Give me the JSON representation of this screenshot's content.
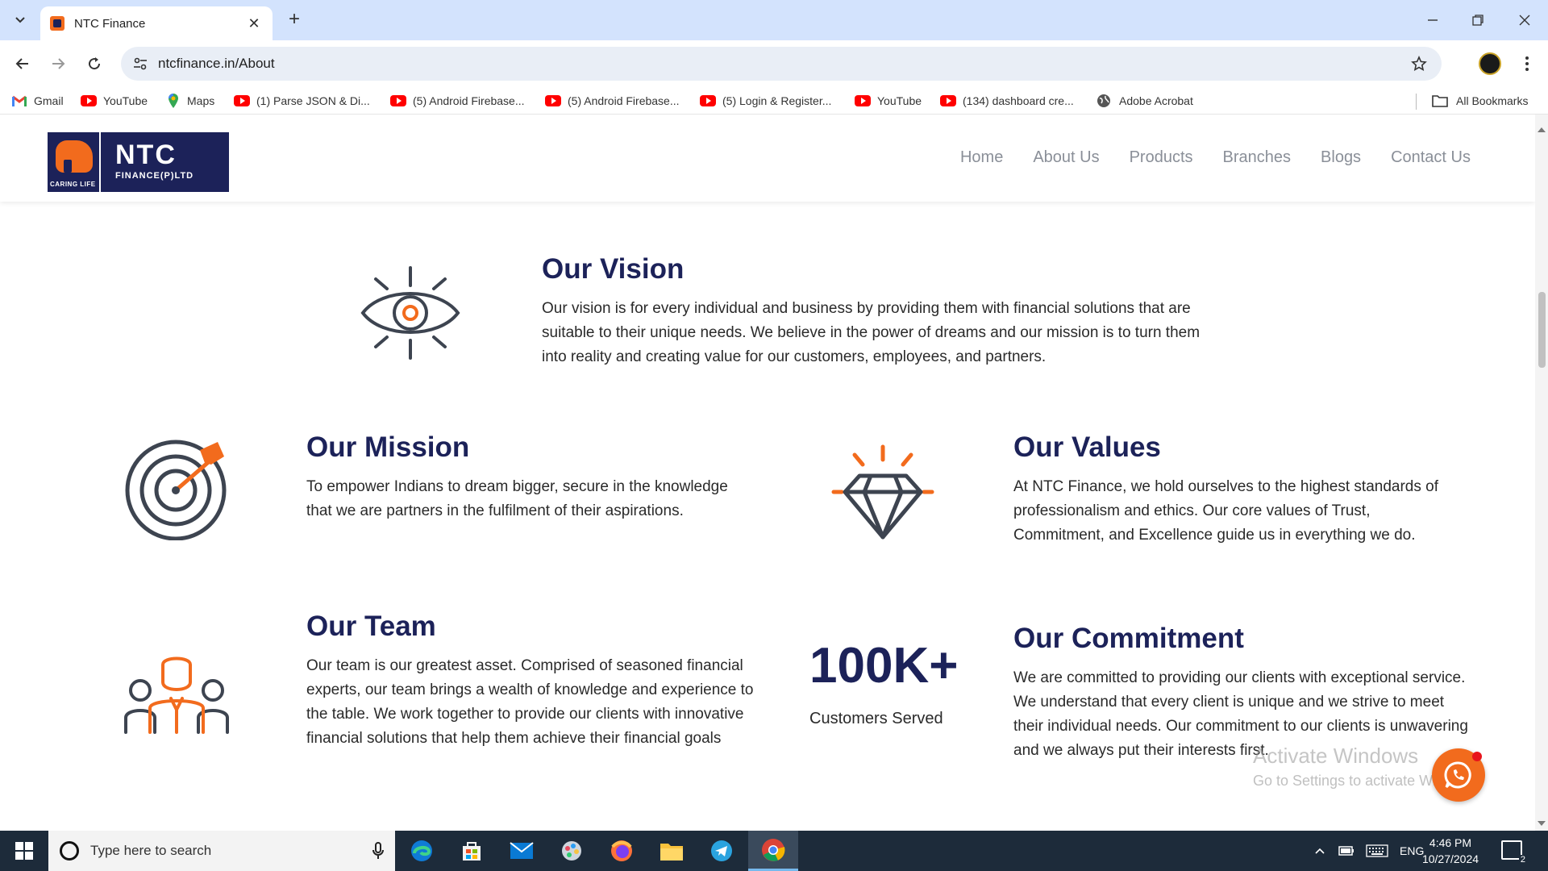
{
  "browser": {
    "tab_title": "NTC Finance",
    "url": "ntcfinance.in/About",
    "new_tab_symbol": "+",
    "close_symbol": "✕"
  },
  "bookmarks": {
    "items": [
      {
        "label": "Gmail",
        "icon": "gmail-icon"
      },
      {
        "label": "YouTube",
        "icon": "youtube-icon"
      },
      {
        "label": "Maps",
        "icon": "maps-icon"
      },
      {
        "label": "(1) Parse JSON & Di...",
        "icon": "youtube-icon"
      },
      {
        "label": "(5) Android Firebase...",
        "icon": "youtube-icon"
      },
      {
        "label": "(5) Android Firebase...",
        "icon": "youtube-icon"
      },
      {
        "label": "(5) Login & Register...",
        "icon": "youtube-icon"
      },
      {
        "label": "YouTube",
        "icon": "youtube-icon"
      },
      {
        "label": "(134) dashboard cre...",
        "icon": "youtube-icon"
      },
      {
        "label": "Adobe Acrobat",
        "icon": "globe-icon"
      }
    ],
    "all_bookmarks": "All Bookmarks"
  },
  "site": {
    "logo": {
      "name": "NTC",
      "sub": "FINANCE(P)LTD",
      "tagline": "CARING LIFE"
    },
    "nav": [
      "Home",
      "About Us",
      "Products",
      "Branches",
      "Blogs",
      "Contact Us"
    ]
  },
  "vision": {
    "title_prefix": "Our",
    "title_bold": "Vision",
    "text": "Our vision is for every individual and business by providing them with financial solutions that are suitable to their unique needs. We believe in the power of dreams and our mission is to turn them into reality and creating value for our customers, employees, and partners."
  },
  "mission": {
    "title_prefix": "Our",
    "title_bold": "Mission",
    "text": "To empower Indians to dream bigger, secure in the knowledge that we are partners in the fulfilment of their aspirations."
  },
  "values": {
    "title_prefix": "Our",
    "title_bold": "Values",
    "text": "At NTC Finance, we hold ourselves to the highest standards of professionalism and ethics. Our core values of Trust, Commitment, and Excellence guide us in everything we do."
  },
  "team": {
    "title_prefix": "Our",
    "title_bold": "Team",
    "text": "Our team is our greatest asset. Comprised of seasoned financial experts, our team brings a wealth of knowledge and experience to the table. We work together to provide our clients with innovative financial solutions that help them achieve their financial goals"
  },
  "stats": {
    "number": "100K+",
    "label": "Customers Served"
  },
  "commitment": {
    "title_prefix": "Our",
    "title_bold": "Commitment",
    "text": "We are committed to providing our clients with exceptional service. We understand that every client is unique and we strive to meet their individual needs. Our commitment to our clients is unwavering and we always put their interests first."
  },
  "watermark": {
    "line1": "Activate Windows",
    "line2": "Go to Settings to activate Windows."
  },
  "taskbar": {
    "search_placeholder": "Type here to search",
    "language": "ENG",
    "time": "4:46 PM",
    "date": "10/27/2024",
    "notification_count": "2"
  },
  "colors": {
    "brand_navy": "#1c2259",
    "brand_orange": "#f26b1d",
    "icon_gray": "#3d4450"
  }
}
